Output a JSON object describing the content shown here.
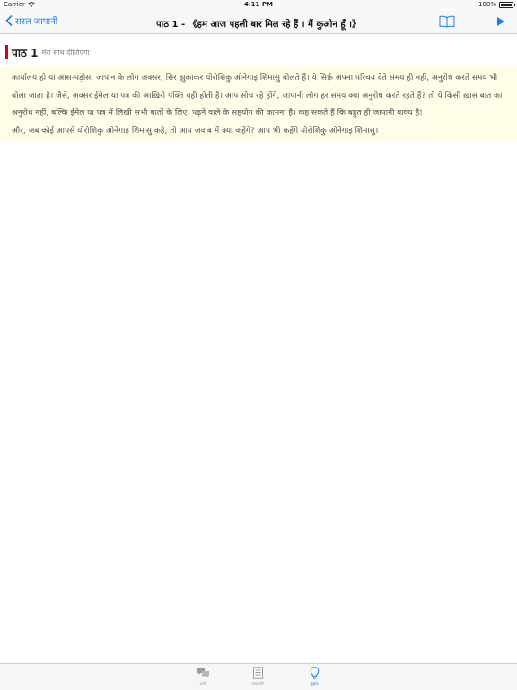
{
  "status": {
    "carrier": "Carrier",
    "time": "4:11 PM",
    "battery": "100%",
    "battery_level": 1.0
  },
  "nav": {
    "back_label": "सरल जापानी",
    "title": "पाठ 1 - 《हम आज पहली बार मिल रहे हैं । मैं कुओन हूँ ।》"
  },
  "lesson": {
    "number": "पाठ 1",
    "subtitle": "मेरा साथ दीजिएगा"
  },
  "content": {
    "paragraph1": "कार्यालय हो या आस-पड़ोस, जापान के लोग अक्सर, सिर झुकाकर योरोशिकु ओनेगाइ शिमासु बोलते हैं। ये सिर्फ़ अपना परिचय देते समय ही नहीं, अनुरोध करते समय भी बोला जाता है। जैसे, अक्सर ईमेल या पत्र की आख़िरी पंक्ति यही होती है। आप सोच रहे होंगे, जापानी लोग हर समय क्या अनुरोध करते रहते हैं? तो ये किसी ख़ास बात का अनुरोध नहीं, बल्कि ईमेल या पत्र में लिखी सभी बातों के लिए, पढ़ने वाले के सहयोग की कामना है। कह सकते हैं कि बहुत ही जापानी वाक्य है!",
    "paragraph2": "और, जब कोई आपसे योरोशिकु ओनेगाइ शिमासु कहे, तो आप जवाब में क्या कहेंगे? आप भी कहेंगे योरोशिकु ओनेगाइ शिमासु।"
  },
  "tabs": [
    {
      "label": "वार्ता",
      "icon": "speech-bubbles-icon",
      "active": false
    },
    {
      "label": "शब्दावली",
      "icon": "document-icon",
      "active": false
    },
    {
      "label": "सुझाव",
      "icon": "lightbulb-icon",
      "active": true
    }
  ],
  "colors": {
    "accent": "#1a7ef5",
    "lesson_marker": "#d0021b",
    "content_bg": "#fdfde8",
    "inactive_tab": "#999999"
  }
}
